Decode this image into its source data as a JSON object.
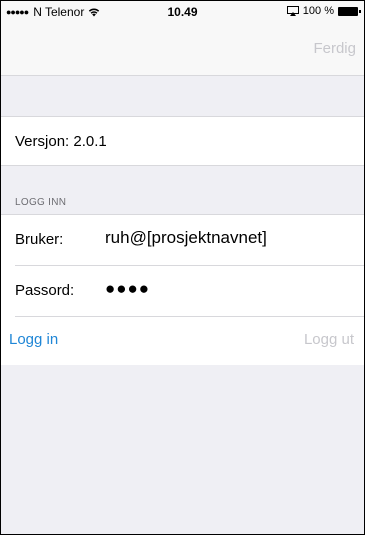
{
  "status_bar": {
    "signal": "●●●●●",
    "carrier": "N Telenor",
    "time": "10.49",
    "battery_percent": "100 %"
  },
  "nav": {
    "done_label": "Ferdig"
  },
  "version": {
    "text": "Versjon:  2.0.1"
  },
  "login": {
    "section_header": "LOGG INN",
    "user_label": "Bruker:",
    "user_value": "ruh@[prosjektnavnet]",
    "password_label": "Passord:",
    "password_mask": "●●●●",
    "login_button": "Logg in",
    "logout_button": "Logg ut"
  },
  "colors": {
    "accent": "#1f86d6",
    "disabled": "#c7c7cc",
    "background": "#efeff4"
  }
}
